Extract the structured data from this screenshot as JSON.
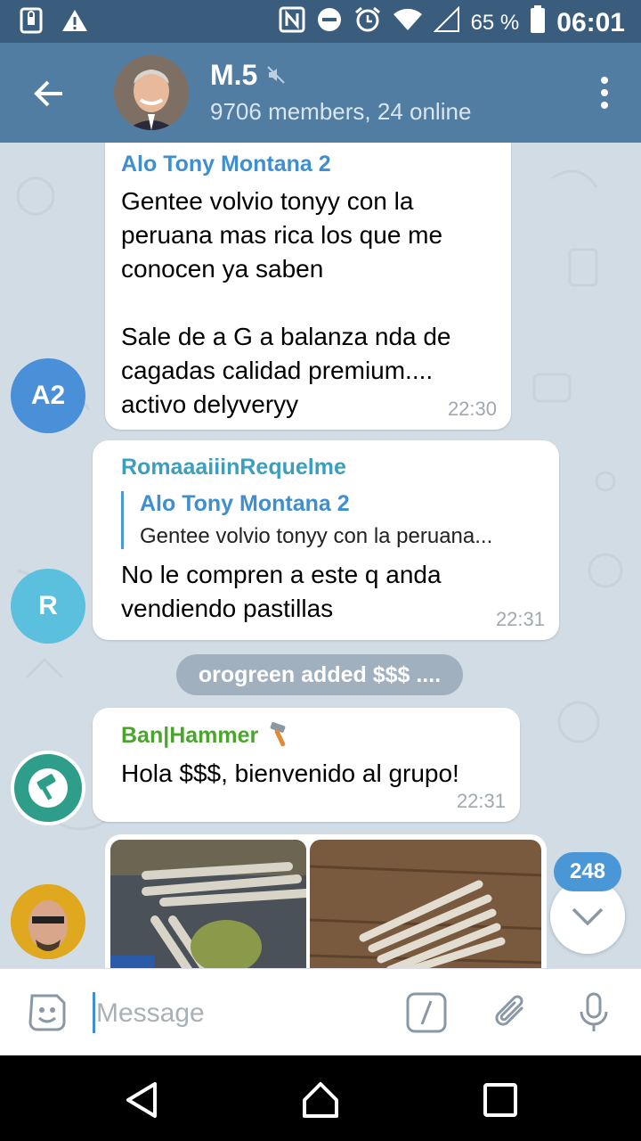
{
  "status_bar": {
    "battery_percent": "65 %",
    "time": "06:01"
  },
  "header": {
    "title": "M.5",
    "subtitle": "9706 members, 24 online"
  },
  "messages": [
    {
      "sender": "Alo Tony Montana 2",
      "avatar_initials": "A2",
      "avatar_color": "#4a90d9",
      "name_color": "#3f8fd0",
      "text": "Gentee volvio tonyy con la peruana mas rica los que me conocen ya saben\n\nSale de a G a balanza nda de cagadas calidad premium.... activo delyveryy",
      "time": "22:30"
    },
    {
      "sender": "RomaaaiiinRequelme",
      "avatar_initials": "R",
      "avatar_color": "#5bc0de",
      "name_color": "#3a9fbf",
      "reply_to": {
        "sender": "Alo Tony Montana 2",
        "text": "Gentee volvio tonyy con la peruana..."
      },
      "text": "No le compren a este q anda vendiendo pastillas",
      "time": "22:31"
    },
    {
      "sender": "Ban|Hammer",
      "name_color": "#4aa52c",
      "sender_icon": "hammer-icon",
      "avatar_label": "BanHammer BOT",
      "avatar_color": "#2e9e8a",
      "text": "Hola $$$, bienvenido al grupo!",
      "time": "22:31"
    }
  ],
  "service_message": "orogreen added $$$ ....",
  "unread_count": "248",
  "input": {
    "placeholder": "Message"
  },
  "colors": {
    "header_bg": "#517da2",
    "status_bg": "#3a5c7d",
    "chat_bg": "#d1dce4",
    "accent": "#4a97d8"
  }
}
